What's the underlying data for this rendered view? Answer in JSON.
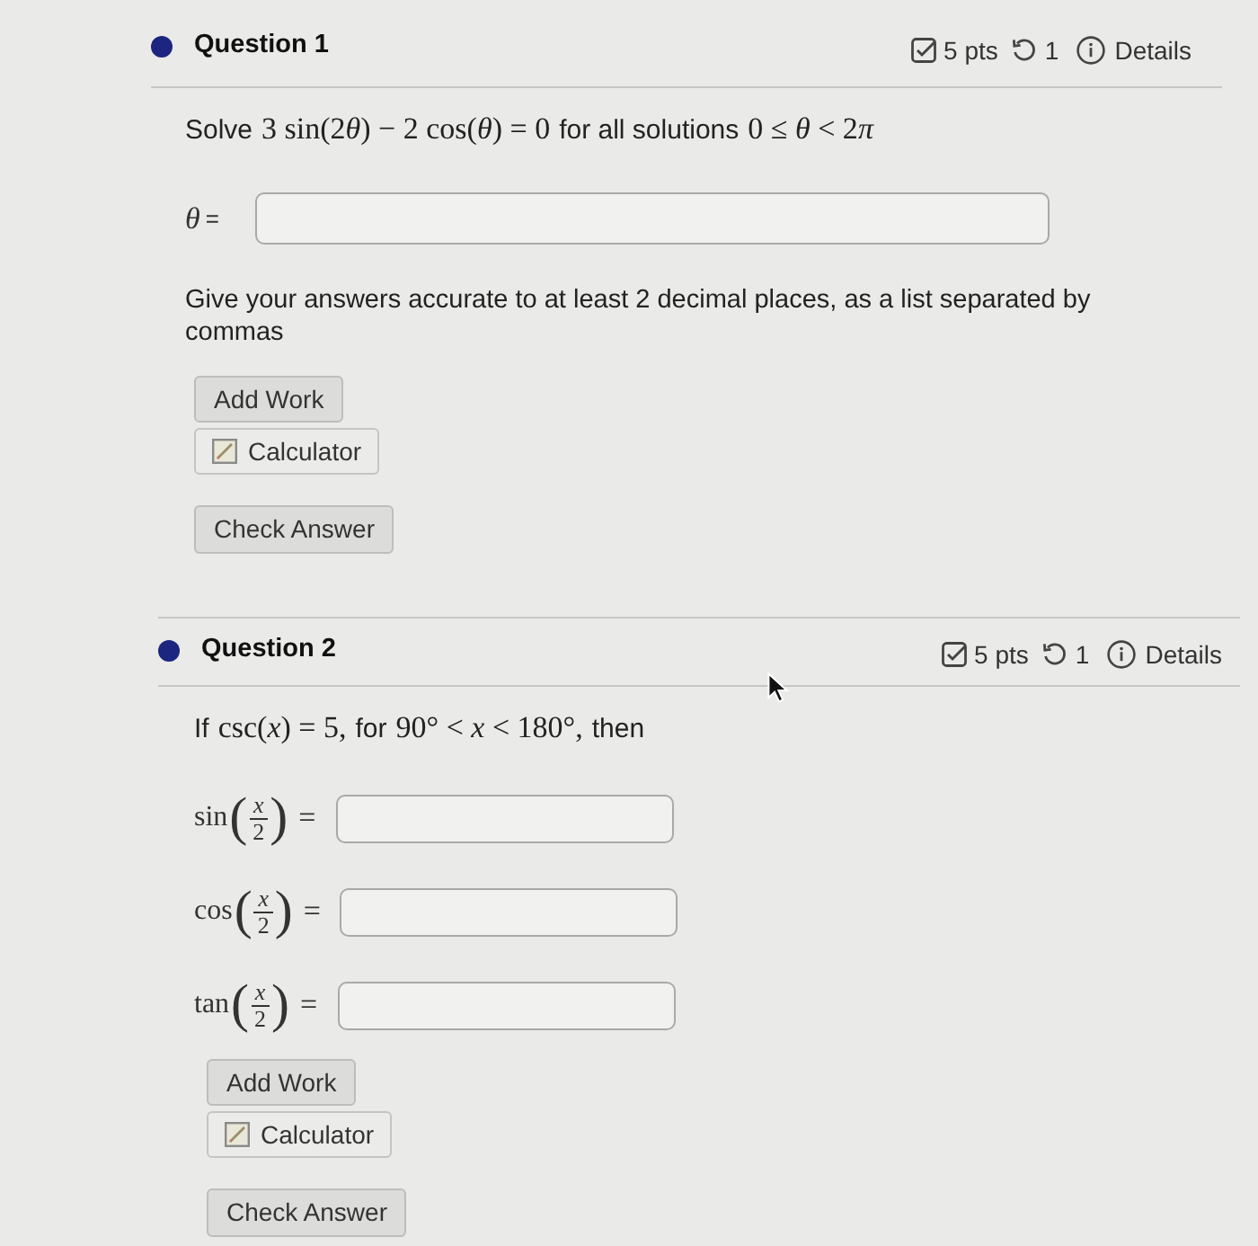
{
  "questions": [
    {
      "title": "Question 1",
      "points": "5 pts",
      "attempts": "1",
      "details": "Details",
      "prompt": [
        {
          "kind": "text",
          "text": "Solve"
        },
        {
          "kind": "math",
          "tokens": [
            {
              "kind": "plain",
              "text": "3 sin(2"
            },
            {
              "kind": "var",
              "text": "θ"
            },
            {
              "kind": "plain",
              "text": ") − 2 cos("
            },
            {
              "kind": "var",
              "text": "θ"
            },
            {
              "kind": "plain",
              "text": ") = 0"
            }
          ]
        },
        {
          "kind": "text",
          "text": "for all solutions"
        },
        {
          "kind": "math",
          "tokens": [
            {
              "kind": "plain",
              "text": "0 ≤ "
            },
            {
              "kind": "var",
              "text": "θ"
            },
            {
              "kind": "plain",
              "text": " < 2"
            },
            {
              "kind": "var",
              "text": "π"
            }
          ]
        }
      ],
      "answers": [
        {
          "kind": "symbol",
          "variable": "θ",
          "relation": "="
        }
      ],
      "instructions": "Give your answers accurate to at least 2 decimal places, as a list separated by commas",
      "buttons": [
        {
          "kind": "plain",
          "label": "Add Work"
        },
        {
          "kind": "calculator",
          "label": "Calculator"
        },
        {
          "kind": "submit",
          "label": "Check Answer"
        }
      ]
    },
    {
      "title": "Question 2",
      "points": "5 pts",
      "attempts": "1",
      "details": "Details",
      "prompt": [
        {
          "kind": "text",
          "text": "If"
        },
        {
          "kind": "math",
          "tokens": [
            {
              "kind": "plain",
              "text": "csc("
            },
            {
              "kind": "var",
              "text": "x"
            },
            {
              "kind": "plain",
              "text": ") = 5,"
            }
          ]
        },
        {
          "kind": "text",
          "text": "for"
        },
        {
          "kind": "math",
          "tokens": [
            {
              "kind": "plain",
              "text": "90° < "
            },
            {
              "kind": "var",
              "text": "x"
            },
            {
              "kind": "plain",
              "text": " < 180°,"
            }
          ]
        },
        {
          "kind": "text",
          "text": "then"
        }
      ],
      "answers": [
        {
          "kind": "fraction",
          "function": "sin",
          "open": "(",
          "numerator": "x",
          "denominator": "2",
          "close": ")",
          "relation": "="
        },
        {
          "kind": "fraction",
          "function": "cos",
          "open": "(",
          "numerator": "x",
          "denominator": "2",
          "close": ")",
          "relation": "="
        },
        {
          "kind": "fraction",
          "function": "tan",
          "open": "(",
          "numerator": "x",
          "denominator": "2",
          "close": ")",
          "relation": "="
        }
      ],
      "buttons": [
        {
          "kind": "plain",
          "label": "Add Work"
        },
        {
          "kind": "calculator",
          "label": "Calculator"
        },
        {
          "kind": "submit",
          "label": "Check Answer"
        }
      ]
    }
  ]
}
